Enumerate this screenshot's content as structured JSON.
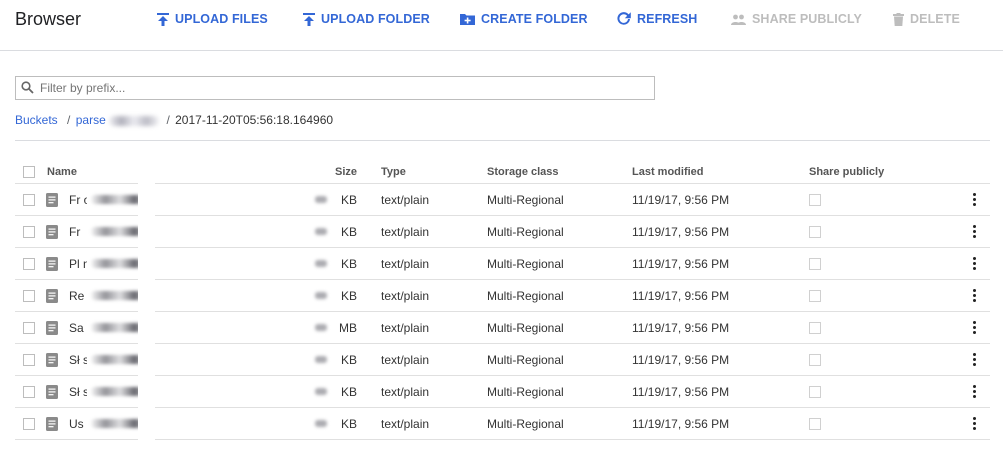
{
  "app": {
    "title": "Browser"
  },
  "toolbar": {
    "upload_files": "UPLOAD FILES",
    "upload_folder": "UPLOAD FOLDER",
    "create_folder": "CREATE FOLDER",
    "refresh": "REFRESH",
    "share_publicly": "SHARE PUBLICLY",
    "delete": "DELETE",
    "accent_color": "#3367d6",
    "disabled_color": "#bdbdbd"
  },
  "filter": {
    "placeholder": "Filter by prefix..."
  },
  "breadcrumb": {
    "root": "Buckets",
    "sep1": "/",
    "bucket": "parse",
    "sep2": "/",
    "current": "2017-11-20T05:56:18.164960"
  },
  "table": {
    "headers": {
      "name": "Name",
      "size": "Size",
      "type": "Type",
      "storage_class": "Storage class",
      "last_modified": "Last modified",
      "share_publicly": "Share publicly"
    },
    "rows": [
      {
        "name": "Fr                on.csv",
        "size": "KB",
        "type": "text/plain",
        "storage_class": "Multi-Regional",
        "last_modified": "11/19/17, 9:56 PM"
      },
      {
        "name": "Fr",
        "size": "KB",
        "type": "text/plain",
        "storage_class": "Multi-Regional",
        "last_modified": "11/19/17, 9:56 PM"
      },
      {
        "name": "Pl                n.csv",
        "size": "KB",
        "type": "text/plain",
        "storage_class": "Multi-Regional",
        "last_modified": "11/19/17, 9:56 PM"
      },
      {
        "name": "Re",
        "size": "KB",
        "type": "text/plain",
        "storage_class": "Multi-Regional",
        "last_modified": "11/19/17, 9:56 PM"
      },
      {
        "name": "Sa                .csv",
        "size": "MB",
        "type": "text/plain",
        "storage_class": "Multi-Regional",
        "last_modified": "11/19/17, 9:56 PM"
      },
      {
        "name": "Sł                s.csv",
        "size": "KB",
        "type": "text/plain",
        "storage_class": "Multi-Regional",
        "last_modified": "11/19/17, 9:56 PM"
      },
      {
        "name": "Sł                sv",
        "size": "KB",
        "type": "text/plain",
        "storage_class": "Multi-Regional",
        "last_modified": "11/19/17, 9:56 PM"
      },
      {
        "name": "Us",
        "size": "KB",
        "type": "text/plain",
        "storage_class": "Multi-Regional",
        "last_modified": "11/19/17, 9:56 PM"
      }
    ]
  }
}
